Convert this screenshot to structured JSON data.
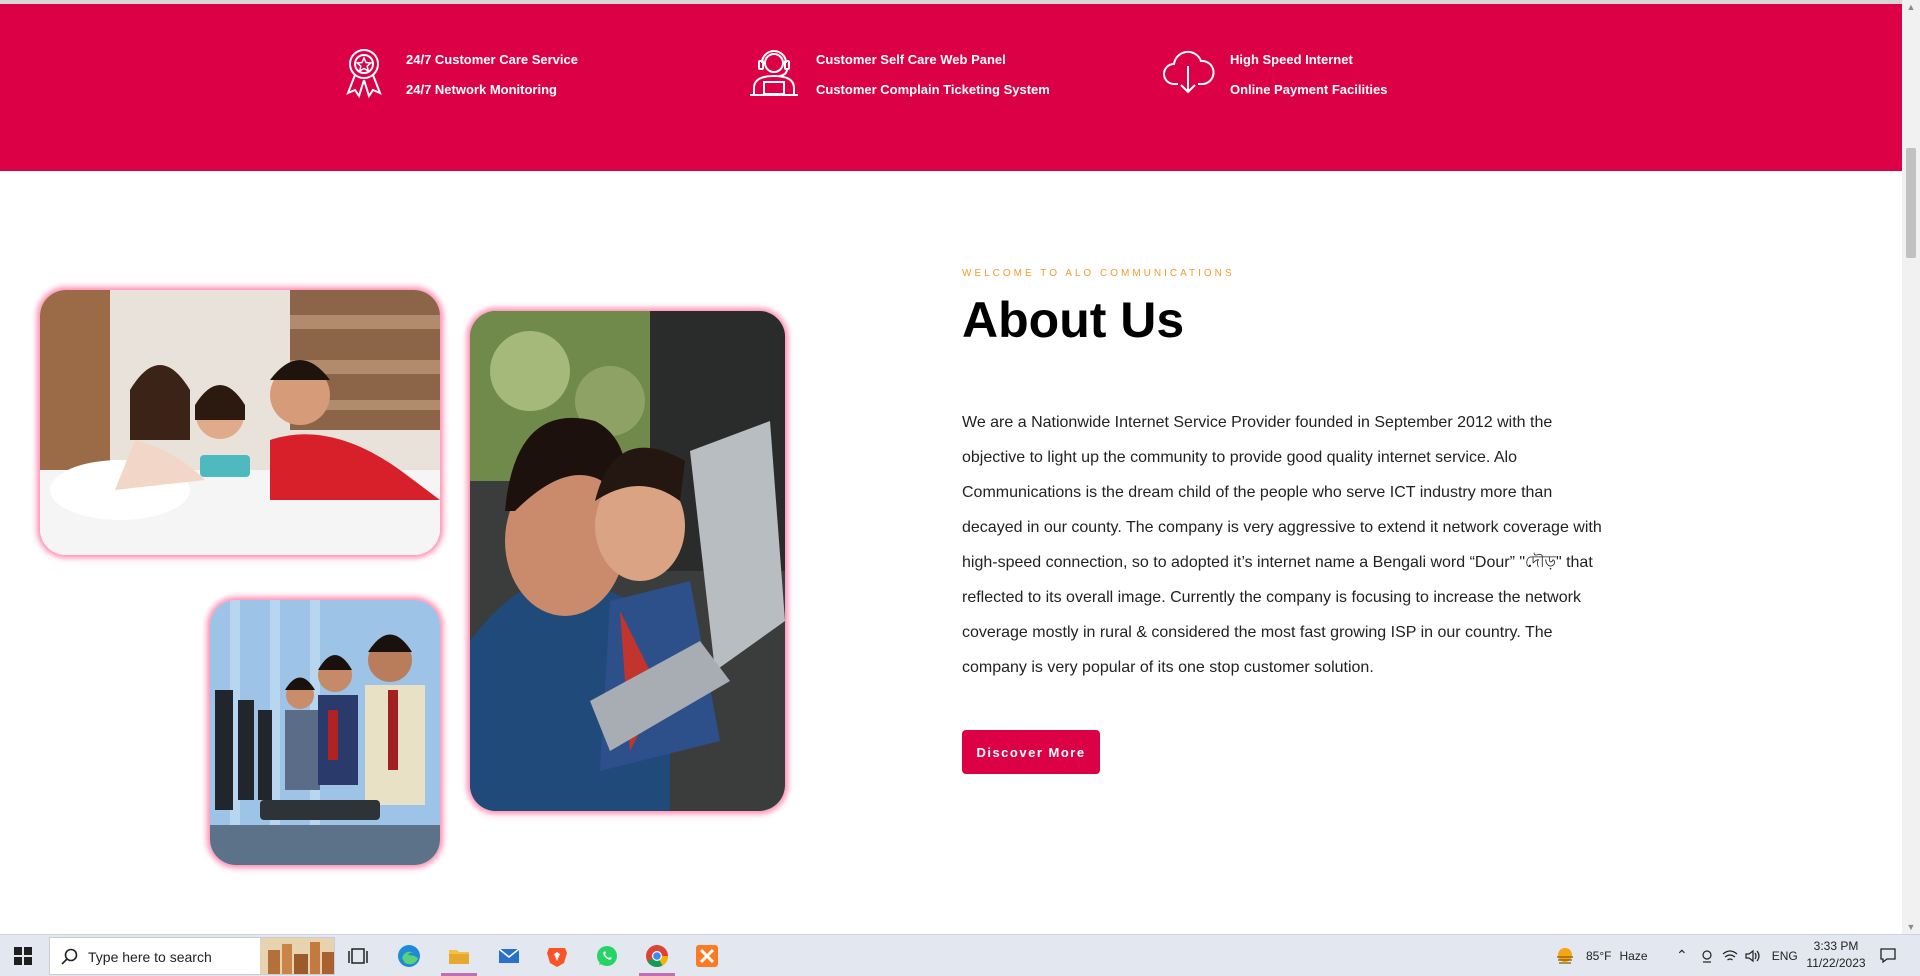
{
  "features": [
    {
      "icon": "award-ribbon-icon",
      "lines": [
        "24/7 Customer Care Service",
        "24/7 Network Monitoring"
      ]
    },
    {
      "icon": "support-agent-icon",
      "lines": [
        "Customer Self Care Web Panel",
        "Customer Complain Ticketing System"
      ]
    },
    {
      "icon": "cloud-download-icon",
      "lines": [
        "High Speed Internet",
        "Online Payment Facilities"
      ]
    }
  ],
  "about": {
    "eyebrow": "WELCOME TO ALO COMMUNICATIONS",
    "title": "About Us",
    "body": "We are a Nationwide Internet Service Provider founded in September 2012 with the objective to light up the community to provide good quality internet service. Alo Communications is the dream child of the people who serve ICT industry more than decayed in our county. The company is very aggressive to extend it network coverage with high-speed connection, so to adopted it’s internet name a Bengali word “Dour” \"দৌড়\" that reflected to its overall image. Currently the company is focusing to increase the network coverage mostly in rural & considered the most fast growing ISP in our country. The company is very popular of its one stop customer solution.",
    "button": "Discover More"
  },
  "colors": {
    "brand": "#dc0046",
    "accent": "#f59b2e"
  },
  "taskbar": {
    "search_placeholder": "Type here to search",
    "apps": [
      "task-view-icon",
      "edge-icon",
      "file-explorer-icon",
      "mail-icon",
      "brave-icon",
      "whatsapp-icon",
      "chrome-icon",
      "xampp-icon"
    ],
    "weather": {
      "temp": "85°F",
      "condition": "Haze"
    },
    "language": "ENG",
    "time": "3:33 PM",
    "date": "11/22/2023"
  }
}
